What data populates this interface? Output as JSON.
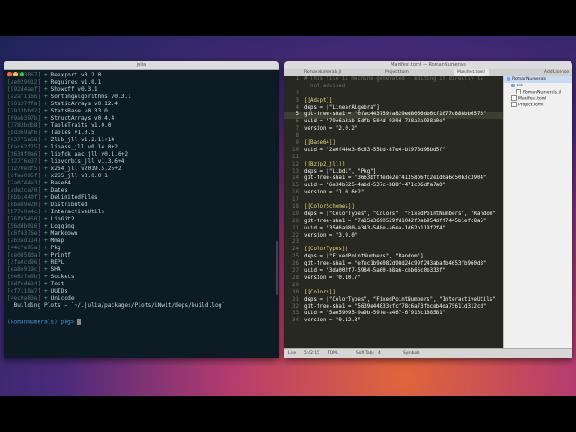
{
  "terminal": {
    "title": "julia",
    "lines": [
      {
        "uuid": "[189a3867]",
        "pkg": "Reexport v0.2.0"
      },
      {
        "uuid": "[ae029012]",
        "pkg": "Requires v1.0.1"
      },
      {
        "uuid": "[992d4aef]",
        "pkg": "Showoff v0.3.1"
      },
      {
        "uuid": "[a2af1166]",
        "pkg": "SortingAlgorithms v0.3.1"
      },
      {
        "uuid": "[90137ffa]",
        "pkg": "StaticArrays v0.12.4"
      },
      {
        "uuid": "[2913bbd2]",
        "pkg": "StatsBase v0.33.0"
      },
      {
        "uuid": "[09ab397b]",
        "pkg": "StructArrays v0.4.4"
      },
      {
        "uuid": "[3783bdb8]",
        "pkg": "TableTraits v1.0.0"
      },
      {
        "uuid": "[bd369af6]",
        "pkg": "Tables v1.0.5"
      },
      {
        "uuid": "[83775a58]",
        "pkg": "Zlib_jll v1.2.11+14"
      },
      {
        "uuid": "[0ac62f75]",
        "pkg": "libass_jll v0.14.0+2"
      },
      {
        "uuid": "[f638f0a6]",
        "pkg": "libfdk_aac_jll v0.1.6+2"
      },
      {
        "uuid": "[f27f6e37]",
        "pkg": "libvorbis_jll v1.3.6+4"
      },
      {
        "uuid": "[1270edf5]",
        "pkg": "x264_jll v2019.5.25+2"
      },
      {
        "uuid": "[dfaa095f]",
        "pkg": "x265_jll v3.0.0+1"
      },
      {
        "uuid": "[2a0f44e3]",
        "pkg": "Base64"
      },
      {
        "uuid": "[ade2ca70]",
        "pkg": "Dates"
      },
      {
        "uuid": "[8bb1440f]",
        "pkg": "DelimitedFiles"
      },
      {
        "uuid": "[8ba89e20]",
        "pkg": "Distributed"
      },
      {
        "uuid": "[b77e0a4c]",
        "pkg": "InteractiveUtils"
      },
      {
        "uuid": "[76f85450]",
        "pkg": "LibGit2"
      },
      {
        "uuid": "[56ddb016]",
        "pkg": "Logging"
      },
      {
        "uuid": "[d6f4376e]",
        "pkg": "Markdown"
      },
      {
        "uuid": "[a63ad114]",
        "pkg": "Mmap"
      },
      {
        "uuid": "[44cfe95a]",
        "pkg": "Pkg"
      },
      {
        "uuid": "[de0858da]",
        "pkg": "Printf"
      },
      {
        "uuid": "[3fa0cd96]",
        "pkg": "REPL"
      },
      {
        "uuid": "[ea8e919c]",
        "pkg": "SHA"
      },
      {
        "uuid": "[6462fe0b]",
        "pkg": "Sockets"
      },
      {
        "uuid": "[8dfed614]",
        "pkg": "Test"
      },
      {
        "uuid": "[cf7118a7]",
        "pkg": "UUIDs"
      },
      {
        "uuid": "[4ec0a83e]",
        "pkg": "Unicode"
      }
    ],
    "plus": "+",
    "building": "  Building Plots → `~/.julia/packages/Plots/LNw1t/deps/build.log`",
    "prompt": "(RomanNumerals) pkg> "
  },
  "editor": {
    "title": "Manifest.toml — RomanNumerals",
    "tabs": [
      "RomanNumerals.jl",
      "Project.toml",
      "Manifest.toml"
    ],
    "tab_action": "Add License",
    "code_lines": [
      {
        "n": "1",
        "text": "# This file is machine-generated - editing it directly is",
        "cls": "comment"
      },
      {
        "n": "",
        "text": "  not advised",
        "cls": "comment"
      },
      {
        "n": "2",
        "text": "",
        "cls": "key"
      },
      {
        "n": "3",
        "text": "[[Adapt]]",
        "cls": "header"
      },
      {
        "n": "4",
        "text": "deps = [\"LinearAlgebra\"]",
        "cls": "key"
      },
      {
        "n": "5",
        "text": "git-tree-sha1 = \"0fac443759fa829ed8066db6cf1077d888bb6573\"",
        "cls": "key"
      },
      {
        "n": "6",
        "text": "uuid = \"79e6a3ab-5dfb-504d-930d-738a2a938a0e\"",
        "cls": "key"
      },
      {
        "n": "7",
        "text": "version = \"2.0.2\"",
        "cls": "key"
      },
      {
        "n": "8",
        "text": "",
        "cls": "key"
      },
      {
        "n": "9",
        "text": "[[Base64]]",
        "cls": "header"
      },
      {
        "n": "10",
        "text": "uuid = \"2a0f44e3-6c83-55bd-87e4-b1978d98bd5f\"",
        "cls": "key"
      },
      {
        "n": "11",
        "text": "",
        "cls": "key"
      },
      {
        "n": "12",
        "text": "[[Bzip2_jll]]",
        "cls": "header"
      },
      {
        "n": "13",
        "text": "deps = [\"Libdl\", \"Pkg\"]",
        "cls": "key"
      },
      {
        "n": "14",
        "text": "git-tree-sha1 = \"3663bfffede2ef41358b6fc2e1d0a6d50b3c3904\"",
        "cls": "key"
      },
      {
        "n": "15",
        "text": "uuid = \"6e34b625-4abd-537c-b88f-471c36dfa7a0\"",
        "cls": "key"
      },
      {
        "n": "16",
        "text": "version = \"1.0.6+2\"",
        "cls": "key"
      },
      {
        "n": "17",
        "text": "",
        "cls": "key"
      },
      {
        "n": "18",
        "text": "[[ColorSchemes]]",
        "cls": "header"
      },
      {
        "n": "19",
        "text": "deps = [\"ColorTypes\", \"Colors\", \"FixedPointNumbers\", \"Random\"",
        "cls": "key"
      },
      {
        "n": "20",
        "text": "git-tree-sha1 = \"7a15e3690529fd1042f0ab954dff7445b1efc8a5\"",
        "cls": "key"
      },
      {
        "n": "21",
        "text": "uuid = \"35d6a980-a343-548e-a6ea-1d62b119f2f4\"",
        "cls": "key"
      },
      {
        "n": "22",
        "text": "version = \"3.9.0\"",
        "cls": "key"
      },
      {
        "n": "23",
        "text": "",
        "cls": "key"
      },
      {
        "n": "24",
        "text": "[[ColorTypes]]",
        "cls": "header"
      },
      {
        "n": "25",
        "text": "deps = [\"FixedPointNumbers\", \"Random\"]",
        "cls": "key"
      },
      {
        "n": "26",
        "text": "git-tree-sha1 = \"efec1b9e082d98d24c99f243abafb4653fb960d8\"",
        "cls": "key"
      },
      {
        "n": "27",
        "text": "uuid = \"3da002f7-5984-5a60-b8a6-cbb66c0b333f\"",
        "cls": "key"
      },
      {
        "n": "28",
        "text": "version = \"0.10.7\"",
        "cls": "key"
      },
      {
        "n": "29",
        "text": "",
        "cls": "key"
      },
      {
        "n": "30",
        "text": "[[Colors]]",
        "cls": "header"
      },
      {
        "n": "31",
        "text": "deps = [\"ColorTypes\", \"FixedPointNumbers\", \"InteractiveUtils\"",
        "cls": "key"
      },
      {
        "n": "32",
        "text": "git-tree-sha1 = \"5639e44833cfcf78c6a73fbceb4da75611d312cd\"",
        "cls": "key"
      },
      {
        "n": "33",
        "text": "uuid = \"5ae59095-9a9b-59fe-a467-6f913c188581\"",
        "cls": "key"
      },
      {
        "n": "34",
        "text": "version = \"0.12.3\"",
        "cls": "key"
      }
    ],
    "current_line": "5",
    "sidebar": [
      {
        "label": "RomanNumerals",
        "type": "folder",
        "indent": 0,
        "selected": true
      },
      {
        "label": "src",
        "type": "folder",
        "indent": 1,
        "selected": false
      },
      {
        "label": "RomanNumerals.jl",
        "type": "file",
        "indent": 2,
        "selected": false
      },
      {
        "label": "Manifest.toml",
        "type": "file",
        "indent": 1,
        "selected": false
      },
      {
        "label": "Project.toml",
        "type": "file",
        "indent": 1,
        "selected": false
      }
    ],
    "status": {
      "file": "Line",
      "position": "5:42:15",
      "language": "TOML",
      "tabs": "Soft Tabs",
      "tab_size": "4",
      "symbol": "Symbols"
    }
  }
}
